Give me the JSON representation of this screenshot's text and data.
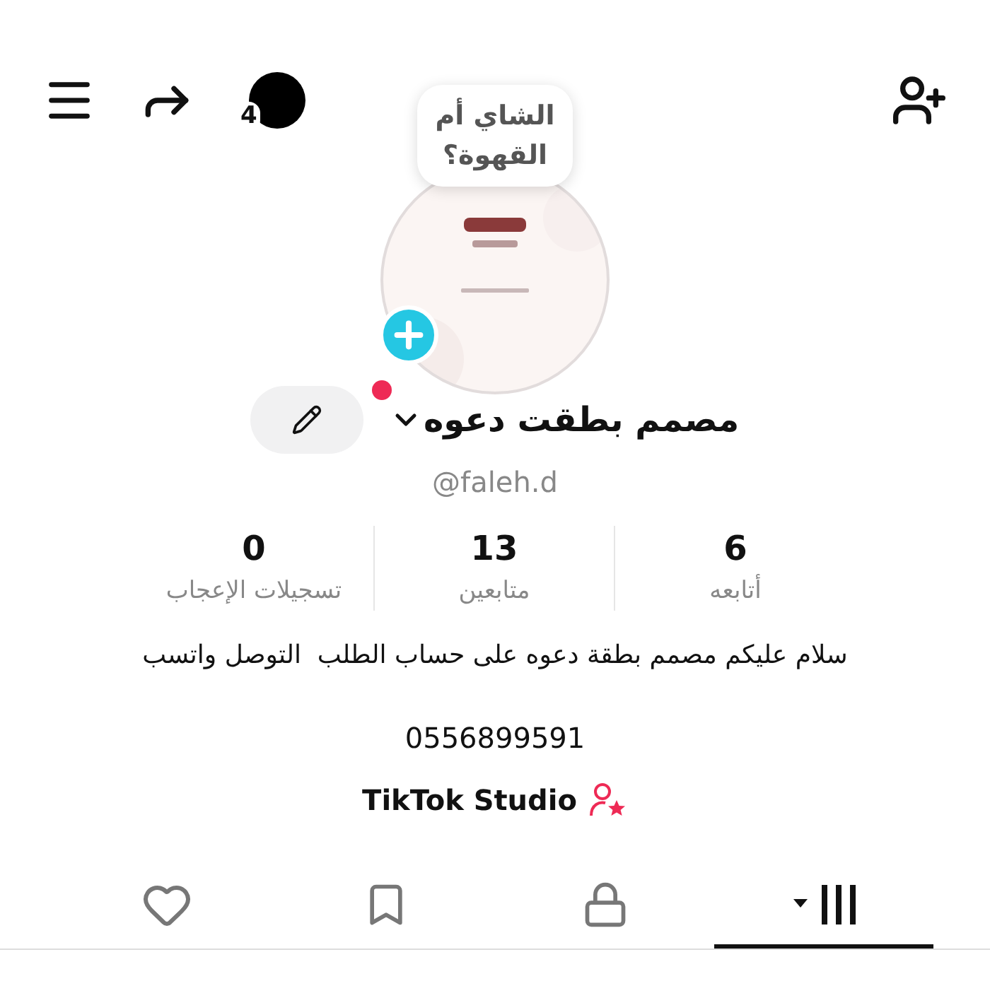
{
  "top_bar": {
    "count": "4"
  },
  "avatar": {
    "bubble": "الشاي أم القهوة؟"
  },
  "profile": {
    "name": "مصمم بطقت دعوه",
    "new_dot": true,
    "handle": "@faleh.d"
  },
  "stats": [
    {
      "value": "6",
      "label": "أتابعه"
    },
    {
      "value": "13",
      "label": "متابعين"
    },
    {
      "value": "0",
      "label": "تسجيلات الإعجاب"
    }
  ],
  "bio": "سلام عليكم مصمم بطقة دعوه على حساب الطلب  التوصل واتسب",
  "phone": "0556899591",
  "studio_link": "TikTok Studio",
  "tabs": [
    {
      "kind": "grid",
      "selected": true
    },
    {
      "kind": "lock",
      "selected": false
    },
    {
      "kind": "bookmark",
      "selected": false
    },
    {
      "kind": "heart",
      "selected": false
    }
  ]
}
